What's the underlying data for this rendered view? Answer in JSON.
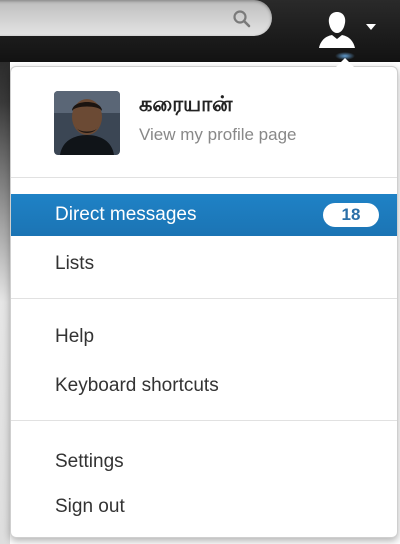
{
  "topbar": {
    "search_icon": "search-icon",
    "user_icon": "user-icon",
    "caret_icon": "caret-down-icon"
  },
  "profile": {
    "name": "கரையான்",
    "subtitle": "View my profile page"
  },
  "menu": {
    "direct_messages": {
      "label": "Direct messages",
      "badge": "18"
    },
    "lists": "Lists",
    "help": "Help",
    "keyboard_shortcuts": "Keyboard shortcuts",
    "settings": "Settings",
    "sign_out": "Sign out"
  },
  "colors": {
    "active_item": "#1f82c6",
    "topbar": "#1c1c1c",
    "muted_text": "#888888"
  }
}
